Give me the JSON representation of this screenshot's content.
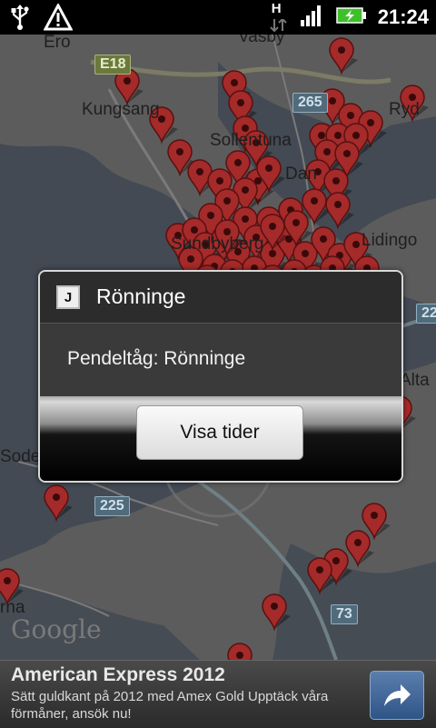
{
  "status_bar": {
    "time": "21:24",
    "network_type": "H",
    "icons": [
      "usb-icon",
      "warning-icon",
      "hspa-data-icon",
      "signal-icon",
      "battery-charging-icon"
    ]
  },
  "map": {
    "labels": [
      "Ero",
      "Kungsang",
      "Sollentuna",
      "Vasby",
      "Dan",
      "Sundbyberg",
      "Lidingo",
      "Ryd",
      "Alta",
      "Sode",
      "rna"
    ],
    "road_shields": [
      "E18",
      "265",
      "225",
      "73",
      "22"
    ],
    "google_logo": "Google",
    "pin_color": "#a52a2a"
  },
  "dialog": {
    "icon_letter": "J",
    "title": "Rönninge",
    "message": "Pendeltåg: Rönninge",
    "button_label": "Visa tider"
  },
  "ad": {
    "title": "American Express 2012",
    "text": "Sätt guldkant på 2012 med Amex Gold Upptäck våra förmåner, ansök nu!",
    "arrow_icon": "share-arrow-icon"
  }
}
